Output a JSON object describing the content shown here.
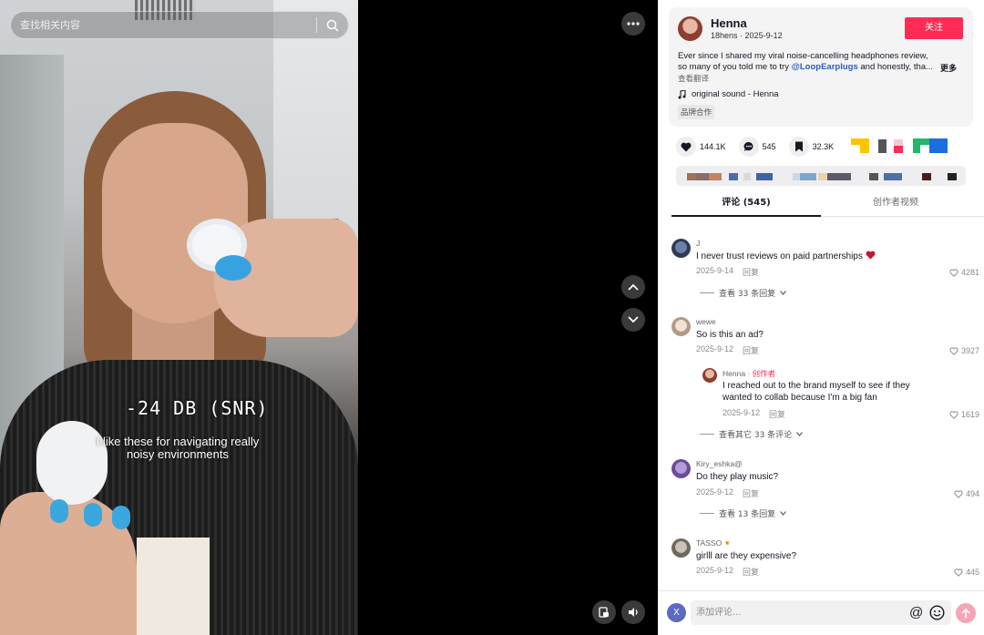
{
  "search": {
    "placeholder": "查找相关内容"
  },
  "video": {
    "overlay_big": "-24 DB (SNR)",
    "overlay_small": "I like these for navigating really noisy environments"
  },
  "post": {
    "author": "Henna",
    "handle": "18hens",
    "date": "2025-9-12",
    "follow_label": "关注",
    "desc_before": "Ever since I shared my viral noise-cancelling headphones review, so many of you told me to try ",
    "desc_mention": "@LoopEarplugs",
    "desc_after": " and honestly, tha...",
    "more_label": "更多",
    "translate_label": "查看翻译",
    "sound": "original sound - Henna",
    "brand_label": "品牌合作"
  },
  "stats": {
    "likes": "144.1K",
    "comments": "545",
    "saves": "32.3K"
  },
  "tabs": {
    "comments": "评论 (545)",
    "creator_videos": "创作者视频"
  },
  "comments": [
    {
      "author": "J",
      "text": "I never trust reviews on paid partnerships",
      "date": "2025-9-14",
      "reply": "回复",
      "likes": "4281",
      "view_replies": "查看 33 条回复"
    },
    {
      "author": "wewe",
      "text": "So is this an ad?",
      "date": "2025-9-12",
      "reply": "回复",
      "likes": "3927",
      "nested": {
        "author": "Henna",
        "creator_tag": "创作者",
        "text1": "I reached out to the brand myself to see if they",
        "text2": "wanted to collab because I'm a big fan",
        "date": "2025-9-12",
        "reply": "回复",
        "likes": "1619"
      },
      "view_replies": "查看其它 33 条评论"
    },
    {
      "author": "Kiry_eshka@",
      "text": "Do they play music?",
      "date": "2025-9-12",
      "reply": "回复",
      "likes": "494",
      "view_replies": "查看 13 条回复"
    },
    {
      "author": "TASSO",
      "text": "girlll are they expensive?",
      "date": "2025-9-12",
      "reply": "回复",
      "likes": "445"
    }
  ],
  "composer": {
    "avatar_letter": "X",
    "placeholder": "添加评论..."
  },
  "colors": {
    "brand_red": "#fe2c55",
    "mention_blue": "#2b5db9",
    "send_pink": "#f7a5b5"
  },
  "icons": [
    "search-icon",
    "more-icon",
    "chevron-up-icon",
    "chevron-down-icon",
    "pip-icon",
    "volume-icon",
    "heart-icon",
    "comment-icon",
    "bookmark-icon",
    "music-note-icon",
    "at-icon",
    "emoji-icon",
    "send-icon"
  ]
}
